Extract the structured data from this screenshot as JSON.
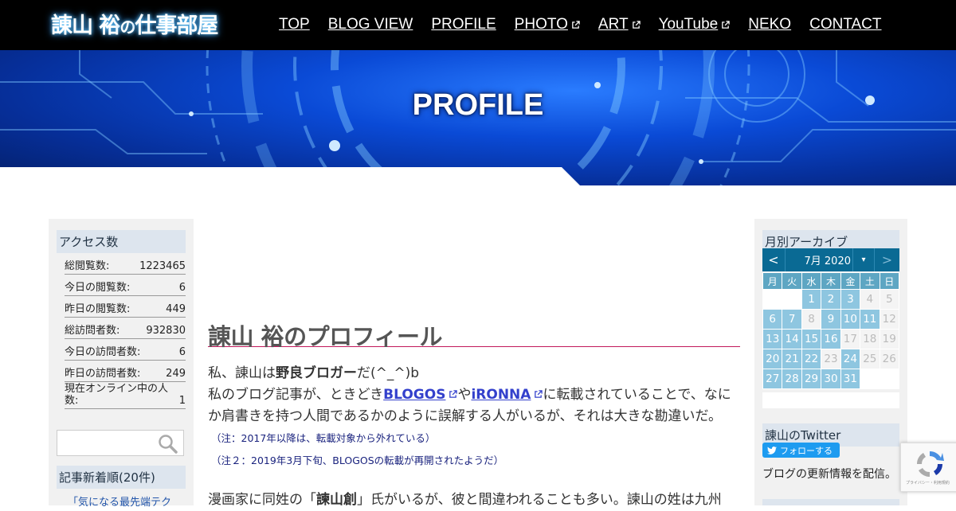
{
  "header": {
    "logo_main": "諌山 裕",
    "logo_no": "の",
    "logo_rest": "仕事部屋",
    "nav": [
      {
        "label": "TOP",
        "external": false
      },
      {
        "label": "BLOG VIEW",
        "external": false
      },
      {
        "label": "PROFILE",
        "external": false
      },
      {
        "label": "PHOTO",
        "external": true
      },
      {
        "label": "ART",
        "external": true
      },
      {
        "label": "YouTube",
        "external": true
      },
      {
        "label": "NEKO",
        "external": false
      },
      {
        "label": "CONTACT",
        "external": false
      }
    ]
  },
  "hero": {
    "title": "PROFILE"
  },
  "left_sidebar": {
    "access_heading": "アクセス数",
    "access_rows": [
      {
        "label": "総閲覧数:",
        "value": "1223465"
      },
      {
        "label": "今日の閲覧数:",
        "value": "6"
      },
      {
        "label": "昨日の閲覧数:",
        "value": "449"
      },
      {
        "label": "総訪問者数:",
        "value": "932830"
      },
      {
        "label": "今日の訪問者数:",
        "value": "6"
      },
      {
        "label": "昨日の訪問者数:",
        "value": "249"
      },
      {
        "label": "現在オンライン中の人数:",
        "value": "1"
      }
    ],
    "search_placeholder": "",
    "recent_heading": "記事新着順(20件)",
    "recent_first": "「気になる最先端テク"
  },
  "main": {
    "title": "諌山 裕のプロフィール",
    "line1_pre": "私、諌山は",
    "line1_bold": "野良ブロガー",
    "line1_post": "だ(^_^)b",
    "line2_pre": "私のブログ記事が、ときどき",
    "link_blogos": "BLOGOS",
    "line2_mid": "や",
    "link_ironna": "iRONNA",
    "line2_post": "に転載されていることで、なにか肩書きを持つ人間であるかのように誤解する人がいるが、それは大きな勘違いだ。",
    "note1": "（注：2017年以降は、転載対象から外れている）",
    "note2": "（注２：2019年3月下旬、BLOGOSの転載が再開されたようだ）",
    "line3_pre": "漫画家に同姓の「",
    "line3_bold": "諫山創",
    "line3_post": "」氏がいるが、彼と間違われることも多い。諫山の姓は九州"
  },
  "right_sidebar": {
    "archive_heading": "月別アーカイブ",
    "calendar": {
      "prev": "<",
      "month_label": "7月 2020",
      "dropdown": "▾",
      "next": ">",
      "weekdays": [
        "月",
        "火",
        "水",
        "木",
        "金",
        "土",
        "日"
      ],
      "weeks": [
        [
          {
            "d": "",
            "t": "e"
          },
          {
            "d": "",
            "t": "e"
          },
          {
            "d": "1",
            "t": "a"
          },
          {
            "d": "2",
            "t": "a"
          },
          {
            "d": "3",
            "t": "a"
          },
          {
            "d": "4",
            "t": "d"
          },
          {
            "d": "5",
            "t": "d"
          }
        ],
        [
          {
            "d": "6",
            "t": "a"
          },
          {
            "d": "7",
            "t": "a"
          },
          {
            "d": "8",
            "t": "d"
          },
          {
            "d": "9",
            "t": "a"
          },
          {
            "d": "10",
            "t": "a"
          },
          {
            "d": "11",
            "t": "a"
          },
          {
            "d": "12",
            "t": "d"
          }
        ],
        [
          {
            "d": "13",
            "t": "a"
          },
          {
            "d": "14",
            "t": "a"
          },
          {
            "d": "15",
            "t": "a"
          },
          {
            "d": "16",
            "t": "a"
          },
          {
            "d": "17",
            "t": "d"
          },
          {
            "d": "18",
            "t": "d"
          },
          {
            "d": "19",
            "t": "d"
          }
        ],
        [
          {
            "d": "20",
            "t": "a"
          },
          {
            "d": "21",
            "t": "a"
          },
          {
            "d": "22",
            "t": "a"
          },
          {
            "d": "23",
            "t": "d"
          },
          {
            "d": "24",
            "t": "a"
          },
          {
            "d": "25",
            "t": "d"
          },
          {
            "d": "26",
            "t": "d"
          }
        ],
        [
          {
            "d": "27",
            "t": "a"
          },
          {
            "d": "28",
            "t": "a"
          },
          {
            "d": "29",
            "t": "a"
          },
          {
            "d": "30",
            "t": "a"
          },
          {
            "d": "31",
            "t": "a"
          },
          {
            "d": "",
            "t": "e"
          },
          {
            "d": "",
            "t": "e"
          }
        ]
      ]
    },
    "twitter_heading": "諌山のTwitter",
    "follow_label": "フォローする",
    "twitter_text": "ブログの更新情報を配信。"
  },
  "recaptcha": {
    "tiny_text": "プライバシー・利用規約"
  },
  "colors": {
    "header_bg": "#000000",
    "hero_blue": "#0a4ad6",
    "link": "#3340cc",
    "title_rule": "#c2185b",
    "calendar_active": "#8ec6e0"
  }
}
